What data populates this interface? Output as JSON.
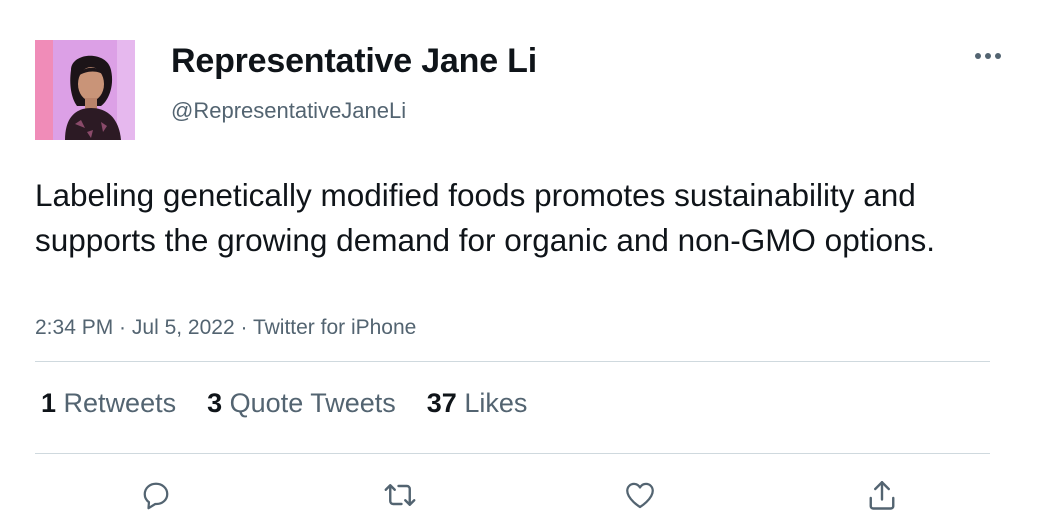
{
  "author": {
    "name": "Representative Jane Li",
    "handle": "@RepresentativeJaneLi"
  },
  "tweet": {
    "text": "Labeling genetically modified foods promotes sustainability and supports the growing demand for organic and non-GMO options.",
    "time": "2:34 PM",
    "date": "Jul 5, 2022",
    "source": "Twitter for iPhone",
    "separator": " · "
  },
  "stats": {
    "retweets_count": "1",
    "retweets_label": "Retweets",
    "quotes_count": "3",
    "quotes_label": "Quote Tweets",
    "likes_count": "37",
    "likes_label": "Likes"
  },
  "icons": {
    "more": "more-horizontal-icon",
    "reply": "reply-icon",
    "retweet": "retweet-icon",
    "like": "heart-icon",
    "share": "share-icon"
  },
  "colors": {
    "text": "#0f1419",
    "secondary": "#536471",
    "divider": "#cfd9de",
    "avatar_bg": "#e79ad0"
  }
}
